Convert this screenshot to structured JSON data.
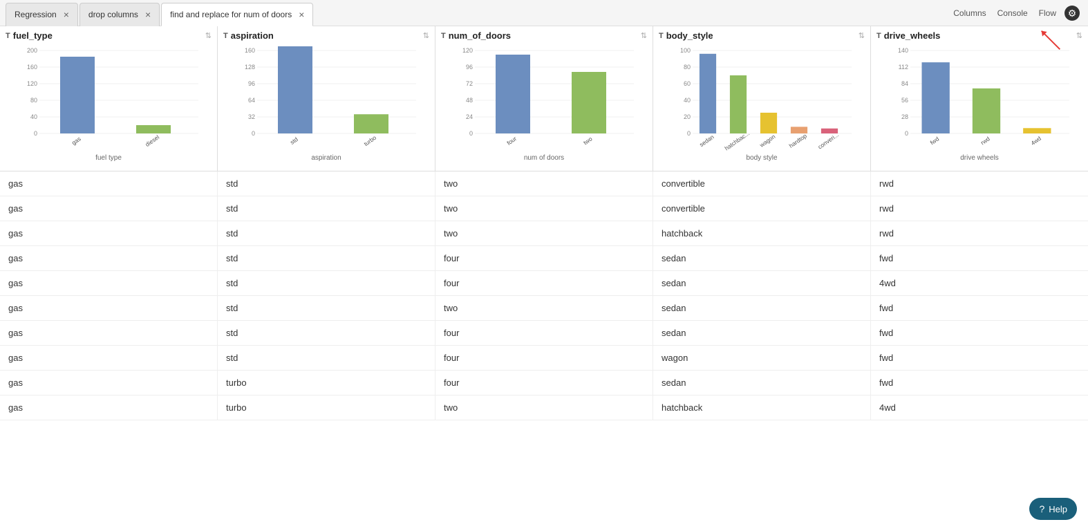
{
  "tabs": [
    {
      "id": "regression",
      "label": "Regression",
      "active": false
    },
    {
      "id": "drop-columns",
      "label": "drop columns",
      "active": false
    },
    {
      "id": "find-replace",
      "label": "find and replace for num of doors",
      "active": true
    }
  ],
  "toolbar": {
    "columns_label": "Columns",
    "console_label": "Console",
    "flow_label": "Flow"
  },
  "columns": [
    {
      "id": "fuel_type",
      "type_icon": "T",
      "label": "fuel_type",
      "chart_label": "fuel type",
      "bars": [
        {
          "label": "gas",
          "value": 185,
          "color": "#6c8ebf"
        },
        {
          "label": "diesel",
          "color": "#8fbc5e",
          "value": 20
        }
      ],
      "y_max": 200
    },
    {
      "id": "aspiration",
      "type_icon": "T",
      "label": "aspiration",
      "chart_label": "aspiration",
      "bars": [
        {
          "label": "std",
          "value": 168,
          "color": "#6c8ebf"
        },
        {
          "label": "turbo",
          "color": "#8fbc5e",
          "value": 37
        }
      ],
      "y_max": 160
    },
    {
      "id": "num_of_doors",
      "type_icon": "T",
      "label": "num_of_doors",
      "chart_label": "num of doors",
      "bars": [
        {
          "label": "four",
          "value": 114,
          "color": "#6c8ebf"
        },
        {
          "label": "two",
          "color": "#8fbc5e",
          "value": 89
        }
      ],
      "y_max": 120
    },
    {
      "id": "body_style",
      "type_icon": "T",
      "label": "body_style",
      "chart_label": "body style",
      "bars": [
        {
          "label": "sedan",
          "value": 96,
          "color": "#6c8ebf"
        },
        {
          "label": "hatchbac...",
          "color": "#8fbc5e",
          "value": 70
        },
        {
          "label": "wagon",
          "color": "#e6c230",
          "value": 25
        },
        {
          "label": "hardtop",
          "color": "#e8a070",
          "value": 8
        },
        {
          "label": "converi...",
          "color": "#d9627a",
          "value": 6
        }
      ],
      "y_max": 100
    },
    {
      "id": "drive_wheels",
      "type_icon": "T",
      "label": "drive_wheels",
      "chart_label": "drive wheels",
      "bars": [
        {
          "label": "fwd",
          "value": 120,
          "color": "#6c8ebf"
        },
        {
          "label": "rwd",
          "color": "#8fbc5e",
          "value": 76
        },
        {
          "label": "4wd",
          "color": "#e6c230",
          "value": 9
        }
      ],
      "y_max": 140
    }
  ],
  "rows": [
    {
      "fuel_type": "gas",
      "aspiration": "std",
      "num_of_doors": "two",
      "body_style": "convertible",
      "drive_wheels": "rwd"
    },
    {
      "fuel_type": "gas",
      "aspiration": "std",
      "num_of_doors": "two",
      "body_style": "convertible",
      "drive_wheels": "rwd"
    },
    {
      "fuel_type": "gas",
      "aspiration": "std",
      "num_of_doors": "two",
      "body_style": "hatchback",
      "drive_wheels": "rwd"
    },
    {
      "fuel_type": "gas",
      "aspiration": "std",
      "num_of_doors": "four",
      "body_style": "sedan",
      "drive_wheels": "fwd"
    },
    {
      "fuel_type": "gas",
      "aspiration": "std",
      "num_of_doors": "four",
      "body_style": "sedan",
      "drive_wheels": "4wd"
    },
    {
      "fuel_type": "gas",
      "aspiration": "std",
      "num_of_doors": "two",
      "body_style": "sedan",
      "drive_wheels": "fwd"
    },
    {
      "fuel_type": "gas",
      "aspiration": "std",
      "num_of_doors": "four",
      "body_style": "sedan",
      "drive_wheels": "fwd"
    },
    {
      "fuel_type": "gas",
      "aspiration": "std",
      "num_of_doors": "four",
      "body_style": "wagon",
      "drive_wheels": "fwd"
    },
    {
      "fuel_type": "gas",
      "aspiration": "turbo",
      "num_of_doors": "four",
      "body_style": "sedan",
      "drive_wheels": "fwd"
    },
    {
      "fuel_type": "gas",
      "aspiration": "turbo",
      "num_of_doors": "two",
      "body_style": "hatchback",
      "drive_wheels": "4wd"
    }
  ],
  "help": {
    "label": "Help"
  }
}
